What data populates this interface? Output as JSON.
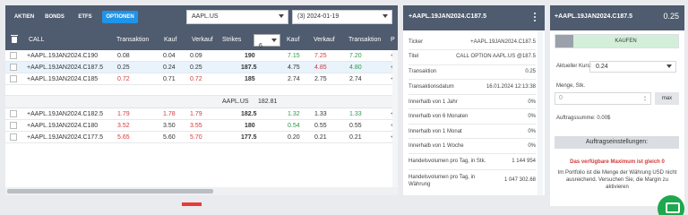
{
  "tabs": [
    "AKTIEN",
    "BONDS",
    "ETFS",
    "OPTIONEN"
  ],
  "active_tab": "OPTIONEN",
  "symbol_select": "AAPL.US",
  "date_select": "(3) 2024-01-19",
  "header": {
    "call": "CALL",
    "transaktion": "Transaktion",
    "kauf": "Kauf",
    "verkauf": "Verkauf",
    "strikes": "Strikes",
    "strikes_value": "6",
    "kauf2": "Kauf",
    "verkauf2": "Verkauf",
    "transaktion2": "Transaktion",
    "p": "P"
  },
  "rows_top": [
    {
      "name": "+AAPL.19JAN2024.C190",
      "t": "0.08",
      "k": "0.04",
      "v": "0.09",
      "s": "190",
      "k2": "7.15",
      "v2": "7.25",
      "t2": "7.20",
      "e": "+"
    },
    {
      "name": "+AAPL.19JAN2024.C187.5",
      "t": "0.25",
      "k": "0.24",
      "v": "0.25",
      "s": "187.5",
      "k2": "4.75",
      "v2": "4.85",
      "t2": "4.80",
      "e": "+"
    },
    {
      "name": "+AAPL.19JAN2024.C185",
      "t": "0.72",
      "k": "0.71",
      "v": "0.72",
      "s": "185",
      "k2": "2.74",
      "v2": "2.75",
      "t2": "2.74",
      "e": "+"
    }
  ],
  "underlying": {
    "name": "AAPL.US",
    "price": "182.81"
  },
  "rows_bottom": [
    {
      "name": "+AAPL.19JAN2024.C182.5",
      "t": "1.79",
      "k": "1.78",
      "v": "1.79",
      "s": "182.5",
      "k2": "1.32",
      "v2": "1.33",
      "t2": "1.33",
      "e": "+"
    },
    {
      "name": "+AAPL.19JAN2024.C180",
      "t": "3.52",
      "k": "3.50",
      "v": "3.55",
      "s": "180",
      "k2": "0.54",
      "v2": "0.55",
      "t2": "0.55",
      "e": "+"
    },
    {
      "name": "+AAPL.19JAN2024.C177.5",
      "t": "5.65",
      "k": "5.60",
      "v": "5.70",
      "s": "177.5",
      "k2": "0.20",
      "v2": "0.21",
      "t2": "0.21",
      "e": "+"
    }
  ],
  "detail": {
    "title": "+AAPL.19JAN2024.C187.5",
    "rows": [
      {
        "k": "Ticker",
        "v": "+AAPL.19JAN2024.C187.5"
      },
      {
        "k": "Titel",
        "v": "CALL OPTION AAPL.US @187.5"
      },
      {
        "k": "Transaktion",
        "v": "0.25"
      },
      {
        "k": "Transaktionsdatum",
        "v": "16.01.2024 12:13:38"
      },
      {
        "k": "Innerhalb von 1 Jahr",
        "v": "0%"
      },
      {
        "k": "Innerhalb von 6 Monaten",
        "v": "0%"
      },
      {
        "k": "Innerhalb von 1 Monat",
        "v": "0%"
      },
      {
        "k": "Innerhalb von 1 Woche",
        "v": "0%"
      },
      {
        "k": "Handelsvolumen pro Tag, in Stk.",
        "v": "1 144 954"
      },
      {
        "k": "Handelsvolumen pro Tag, in Währung",
        "v": "1 047 302.68"
      }
    ]
  },
  "order": {
    "title": "+AAPL.19JAN2024.C187.5",
    "price": "0.25",
    "buy_label": "KAUFEN",
    "kurs_label": "Aktueller Kurs:",
    "kurs_value": "0.24",
    "menge_label": "Menge, Stk.",
    "menge_placeholder": "0",
    "max_label": "max",
    "sum_label": "Auftragssumme: 0.00$",
    "settings_label": "Auftragseinstellungen:",
    "warning_title": "Das verfügbare Maximum ist gleich 0",
    "warning_text": "Im Portfolio ist die Menge der Währung USD nicht ausreichend. Versuchen Sie, die Margin zu aktivieren"
  },
  "colors": {
    "header_bg": "#4f5b6e",
    "accent": "#1f94e8",
    "negative": "#d33a3a",
    "positive": "#2a9a48",
    "buy_bg": "#d3efd9"
  }
}
